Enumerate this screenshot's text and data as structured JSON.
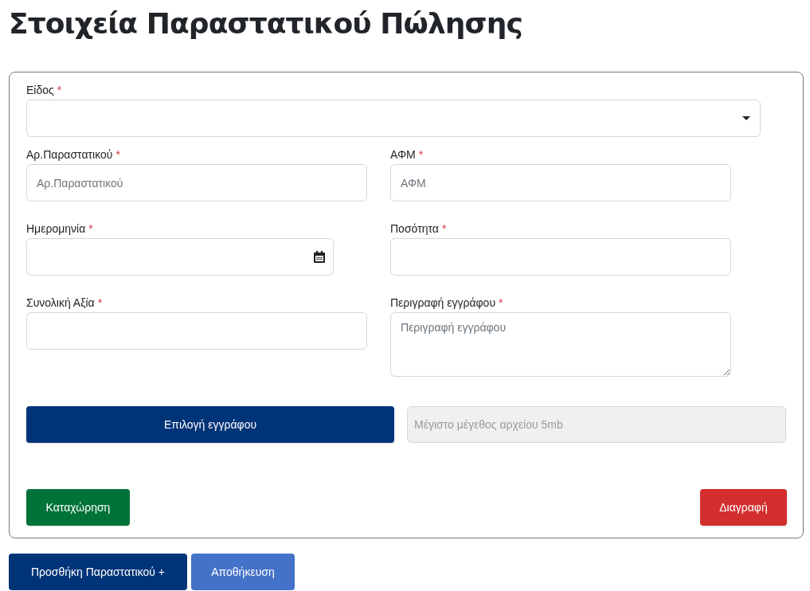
{
  "title": "Στοιχεία Παραστατικού Πώλησης",
  "type_field": {
    "label": "Είδος",
    "required_marker": "*"
  },
  "rows": [
    [
      {
        "kind": "text",
        "label": "Αρ.Παραστατικού",
        "required_marker": "*",
        "placeholder": "Αρ.Παραστατικού"
      },
      {
        "kind": "text",
        "label": "ΑΦΜ",
        "required_marker": "*",
        "placeholder": "ΑΦΜ"
      }
    ],
    [
      {
        "kind": "date",
        "label": "Ημερομηνία",
        "required_marker": "*"
      },
      {
        "kind": "text",
        "label": "Ποσότητα",
        "required_marker": "*"
      }
    ],
    [
      {
        "kind": "text",
        "label": "Συνολική Αξία",
        "required_marker": "*"
      },
      {
        "kind": "textarea",
        "label": "Περιγραφή εγγράφου",
        "required_marker": "*",
        "placeholder": "Περιγραφή εγγράφου"
      }
    ]
  ],
  "file_button": "Επιλογή εγγράφου",
  "file_info": {
    "placeholder": "Μέγιστο μέγεθος αρχείου 5mb"
  },
  "submit_button": "Καταχώρηση",
  "delete_button": "Διαγραφή",
  "add_button": "Προσθήκη Παραστατικού +",
  "save_button": "Αποθήκευση"
}
